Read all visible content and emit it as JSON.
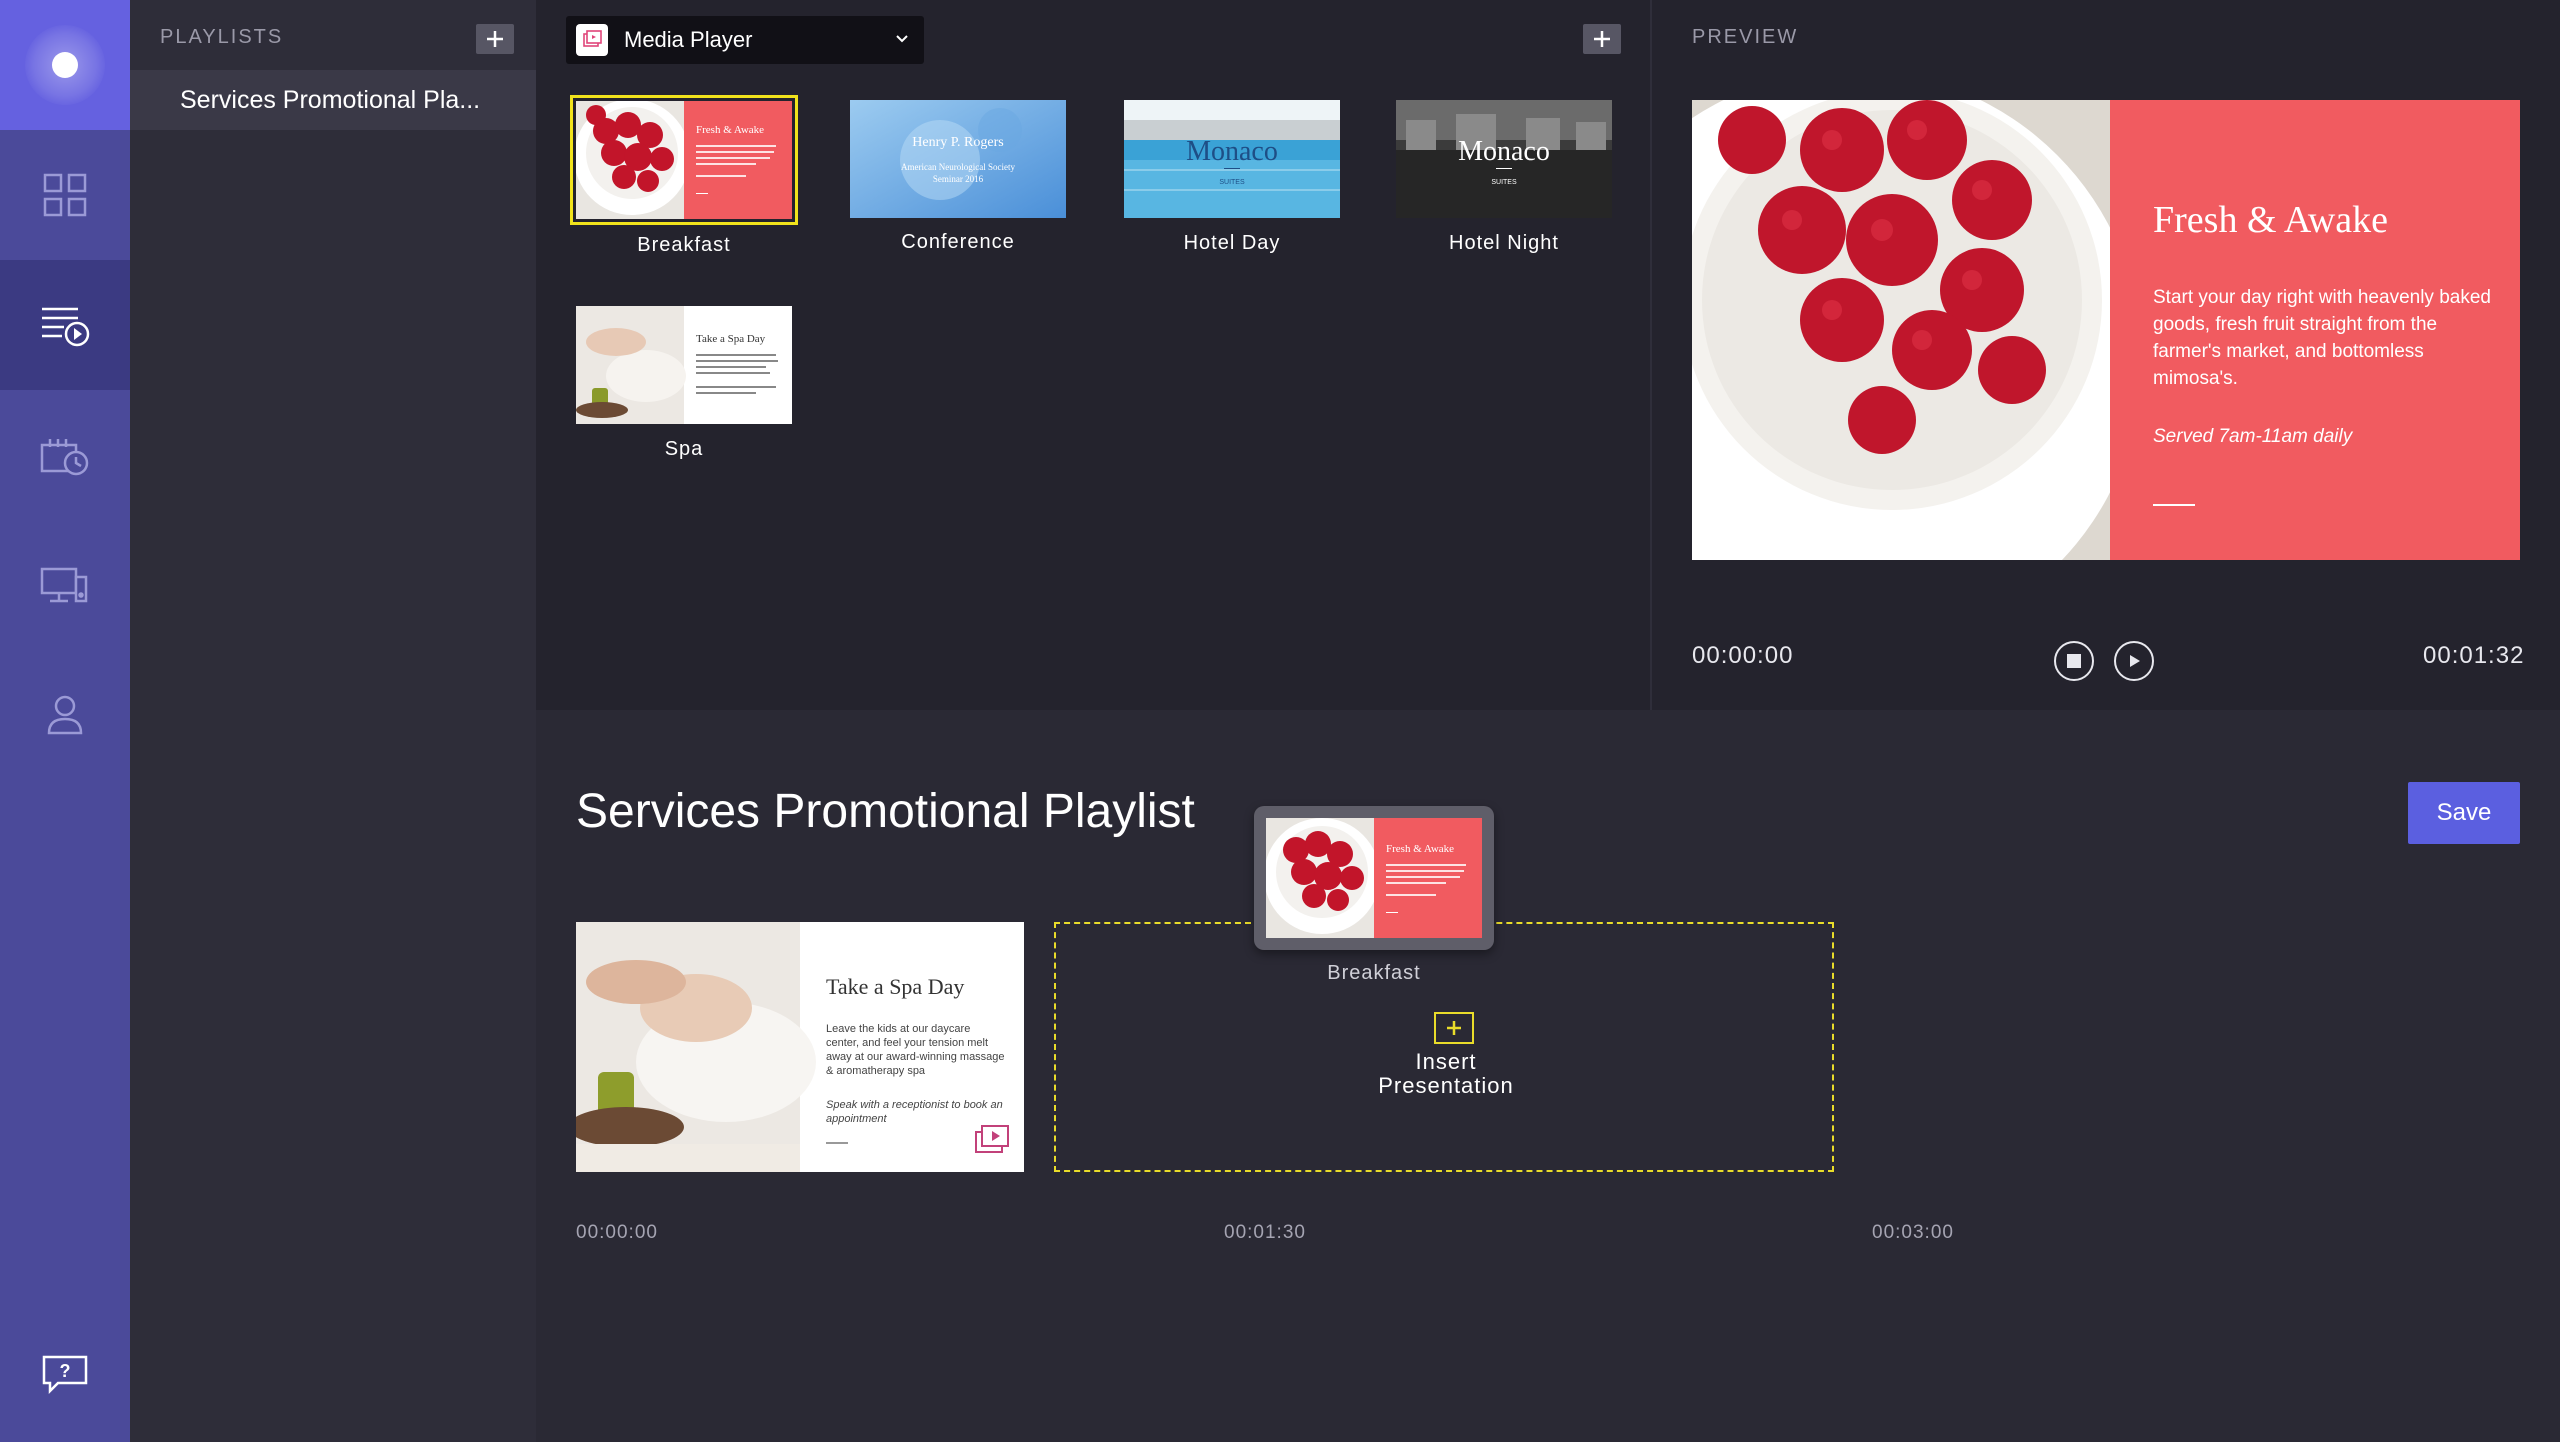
{
  "nav": {
    "items": [
      "dashboard",
      "playlists",
      "schedule",
      "displays",
      "account"
    ],
    "help": "help"
  },
  "playlists": {
    "header": "PLAYLISTS",
    "items": [
      "Services Promotional Pla..."
    ]
  },
  "library": {
    "selector_label": "Media Player",
    "presentations": [
      {
        "label": "Breakfast"
      },
      {
        "label": "Conference",
        "slide_title": "Henry P. Rogers",
        "slide_sub1": "American Neurological Society",
        "slide_sub2": "Seminar 2016"
      },
      {
        "label": "Hotel Day",
        "slide_title": "Monaco",
        "slide_sub": "SUITES"
      },
      {
        "label": "Hotel Night",
        "slide_title": "Monaco",
        "slide_sub": "SUITES"
      },
      {
        "label": "Spa"
      }
    ]
  },
  "slides": {
    "breakfast": {
      "title": "Fresh & Awake",
      "body": "Start your day right with heavenly baked goods, fresh fruit straight from the farmer's market, and bottomless mimosa's.",
      "note": "Served 7am-11am daily"
    },
    "spa": {
      "title": "Take a Spa Day",
      "body": "Leave the kids at our daycare center, and feel your tension melt away at our award-winning massage & aromatherapy spa",
      "note": "Speak with a receptionist to book an appointment"
    }
  },
  "preview": {
    "header": "PREVIEW",
    "time_current": "00:00:00",
    "time_total": "00:01:32"
  },
  "editor": {
    "title": "Services Promotional Playlist",
    "save_label": "Save",
    "drag_label": "Breakfast",
    "insert_label_1": "Insert",
    "insert_label_2": "Presentation",
    "ticks": [
      "00:00:00",
      "00:01:30",
      "00:03:00"
    ]
  },
  "colors": {
    "accent": "#5b5fe0",
    "rail": "#4b4a9a",
    "highlight": "#f1e31c",
    "coral": "#f15b60"
  }
}
